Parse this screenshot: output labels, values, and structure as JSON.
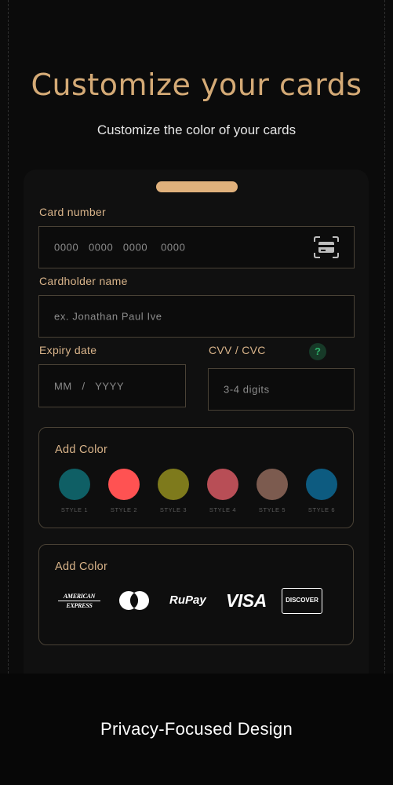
{
  "hero": {
    "title": "Customize your cards",
    "subtitle": "Customize the color of your cards"
  },
  "form": {
    "card_number": {
      "label": "Card number",
      "placeholder": "0000   0000   0000    0000"
    },
    "cardholder": {
      "label": "Cardholder name",
      "placeholder": "ex. Jonathan Paul Ive"
    },
    "expiry": {
      "label": "Expiry date",
      "placeholder": "MM   /   YYYY"
    },
    "cvv": {
      "label": "CVV / CVC",
      "placeholder": "3-4 digits",
      "help_glyph": "?"
    }
  },
  "colors": {
    "title": "Add Color",
    "swatches": [
      {
        "label": "STYLE 1",
        "color": "#0f5f65"
      },
      {
        "label": "STYLE 2",
        "color": "#ff5252"
      },
      {
        "label": "STYLE 3",
        "color": "#7e7a1c"
      },
      {
        "label": "STYLE 4",
        "color": "#b84e56"
      },
      {
        "label": "STYLE 5",
        "color": "#7c5b4f"
      },
      {
        "label": "STYLE 6",
        "color": "#0d5b80"
      }
    ]
  },
  "brands": {
    "title": "Add Color",
    "items": [
      {
        "name": "amex",
        "line1": "AMERICAN",
        "line2": "EXPRESS"
      },
      {
        "name": "mastercard"
      },
      {
        "name": "rupay",
        "text": "RuPay"
      },
      {
        "name": "visa",
        "text": "VISA"
      },
      {
        "name": "discover",
        "text": "DISCOVER"
      }
    ]
  },
  "footer": {
    "text": "Privacy-Focused Design"
  },
  "theme": {
    "accent": "#d4aa76",
    "background": "#0b0b0b",
    "border": "#4a4236"
  }
}
